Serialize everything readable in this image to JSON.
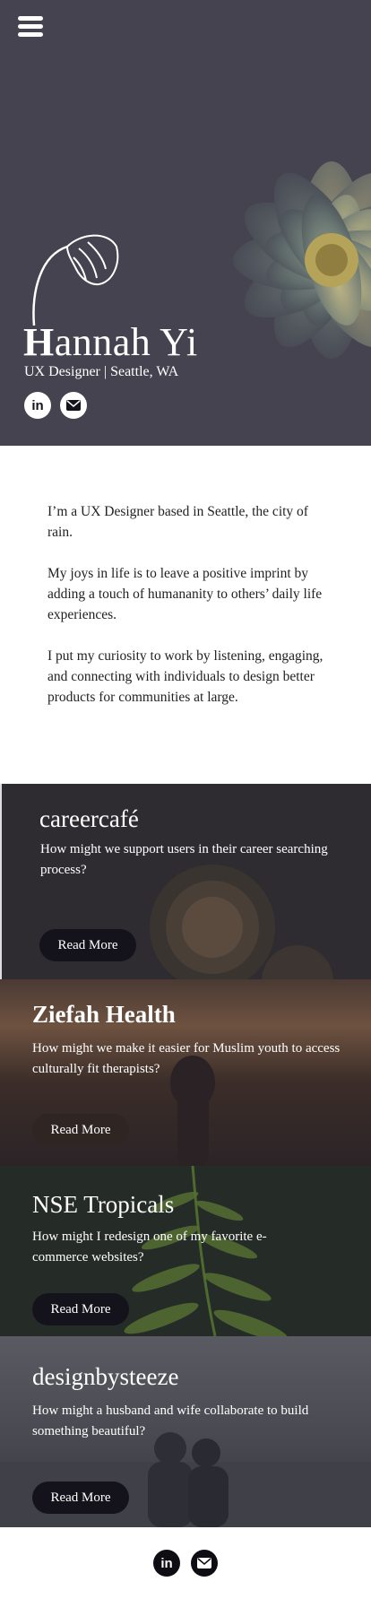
{
  "header": {
    "menu_icon": "hamburger-menu-icon",
    "name_initial": "H",
    "name_rest": "annah Yi",
    "subtitle": "UX Designer | Seattle, WA",
    "social": [
      {
        "icon": "linkedin-icon",
        "label": "in"
      },
      {
        "icon": "mail-icon"
      }
    ]
  },
  "about": {
    "paragraphs": [
      "I’m a UX Designer based in Seattle, the city of rain.",
      "My joys in life is to leave a positive imprint by adding a touch of humananity to others’ daily life experiences.",
      "I put my curiosity to work by listening, engaging, and connecting with individuals to design better products for communities at large."
    ]
  },
  "projects": [
    {
      "title": "careercafé",
      "question": "How might we support users in their career searching process?",
      "button": "Read More"
    },
    {
      "title": "Ziefah Health",
      "question": "How might we make it easier for Muslim youth to access culturally fit therapists?",
      "button": "Read More"
    },
    {
      "title": "NSE Tropicals",
      "question": "How might I redesign one of my favorite e-commerce websites?",
      "button": "Read More"
    },
    {
      "title": "designbysteeze",
      "question": "How might a husband and wife collaborate to build something beautiful?",
      "button": "Read More"
    }
  ],
  "footer": {
    "social": [
      {
        "icon": "linkedin-icon",
        "label": "in"
      },
      {
        "icon": "mail-icon"
      }
    ]
  }
}
